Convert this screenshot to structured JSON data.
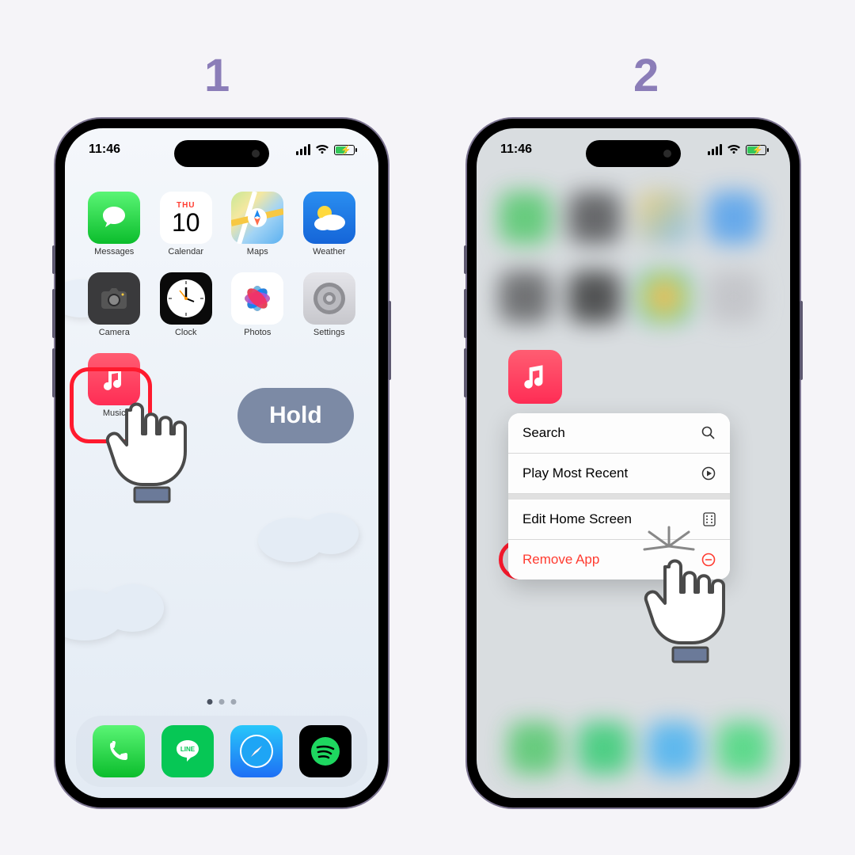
{
  "steps": {
    "one": "1",
    "two": "2"
  },
  "holdLabel": "Hold",
  "statusBar": {
    "time": "11:46"
  },
  "apps_row1": [
    {
      "name": "Messages"
    },
    {
      "name": "Calendar",
      "day": "THU",
      "date": "10"
    },
    {
      "name": "Maps"
    },
    {
      "name": "Weather"
    }
  ],
  "apps_row2": [
    {
      "name": "Camera"
    },
    {
      "name": "Clock"
    },
    {
      "name": "Photos"
    },
    {
      "name": "Settings"
    }
  ],
  "apps_row3": [
    {
      "name": "Music"
    }
  ],
  "contextMenu": {
    "search": "Search",
    "playRecent": "Play Most Recent",
    "editHome": "Edit Home Screen",
    "removeApp": "Remove App"
  },
  "colors": {
    "accentPurple": "#8b7db8",
    "highlightRed": "#ff1a2e",
    "removeRed": "#ff3b30",
    "holdPill": "#7c8aa5"
  }
}
